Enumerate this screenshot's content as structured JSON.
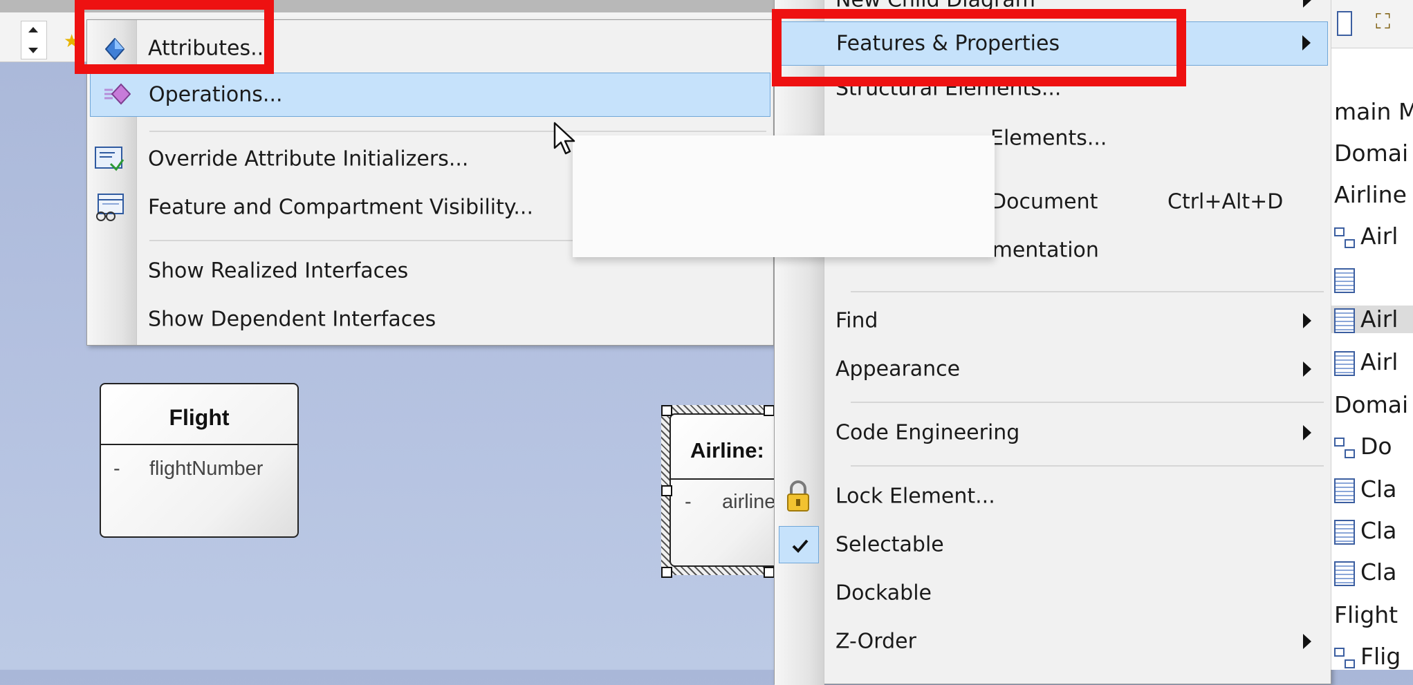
{
  "diagram": {
    "class_flight": {
      "name": "Flight",
      "attr_visibility": "-",
      "attr": "flightNumber"
    },
    "class_airline": {
      "name": "Airline:",
      "attr_visibility": "-",
      "attr": "airline"
    }
  },
  "submenu_features": {
    "items": [
      {
        "label": "Attributes...",
        "icon": "attribute-icon"
      },
      {
        "label": "Operations...",
        "icon": "operation-icon",
        "highlighted": true
      },
      {
        "label": "Override Attribute Initializers...",
        "icon": "override-initializers-icon"
      },
      {
        "label": "Feature and Compartment Visibility...",
        "icon": "visibility-icon"
      },
      {
        "label": "Show Realized Interfaces"
      },
      {
        "label": "Show Dependent Interfaces"
      }
    ]
  },
  "context_menu": {
    "items": [
      {
        "label": "New Child Diagram",
        "submenu": true
      },
      {
        "label": "Features & Properties",
        "submenu": true,
        "highlighted": true
      },
      {
        "label": "Structural Elements..."
      },
      {
        "label": "Elements...",
        "partially_hidden": true
      },
      {
        "label": "Document",
        "shortcut": "Ctrl+Alt+D",
        "partially_hidden": true
      },
      {
        "label": "Generate Documentation"
      },
      {
        "label": "Find",
        "submenu": true
      },
      {
        "label": "Appearance",
        "submenu": true
      },
      {
        "label": "Code Engineering",
        "submenu": true
      },
      {
        "label": "Lock Element...",
        "icon": "lock-icon"
      },
      {
        "label": "Selectable",
        "checked": true
      },
      {
        "label": "Dockable"
      },
      {
        "label": "Z-Order",
        "submenu": true
      }
    ]
  },
  "project_browser": {
    "items": [
      {
        "label": "main M",
        "icon": "none"
      },
      {
        "label": "Domai",
        "icon": "none"
      },
      {
        "label": "Airline",
        "icon": "none"
      },
      {
        "label": "Airl",
        "icon": "diagram-icon"
      },
      {
        "label": "",
        "icon": "class-icon"
      },
      {
        "label": "Airl",
        "icon": "class-icon",
        "selected": true
      },
      {
        "label": "Airl",
        "icon": "class-icon"
      },
      {
        "label": "Domai",
        "icon": "none"
      },
      {
        "label": "Do",
        "icon": "diagram-icon"
      },
      {
        "label": "Cla",
        "icon": "class-icon"
      },
      {
        "label": "Cla",
        "icon": "class-icon"
      },
      {
        "label": "Cla",
        "icon": "class-icon"
      },
      {
        "label": "Flight",
        "icon": "none"
      },
      {
        "label": "Flig",
        "icon": "diagram-icon"
      }
    ]
  },
  "colors": {
    "callout": "#ee1111",
    "highlight": "#c6e2fb",
    "diagram_bg": "#b4c1e0"
  }
}
